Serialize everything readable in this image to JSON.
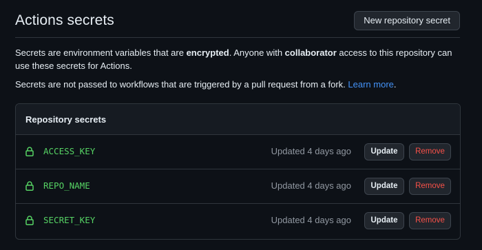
{
  "header": {
    "title": "Actions secrets",
    "new_secret_label": "New repository secret"
  },
  "description": {
    "p1_part1": "Secrets are environment variables that are ",
    "p1_bold1": "encrypted",
    "p1_part2": ". Anyone with ",
    "p1_bold2": "collaborator",
    "p1_part3": " access to this repository can use these secrets for Actions.",
    "p2_text": "Secrets are not passed to workflows that are triggered by a pull request from a fork. ",
    "p2_link": "Learn more",
    "p2_end": "."
  },
  "secrets": {
    "title": "Repository secrets",
    "items": [
      {
        "name": "ACCESS_KEY",
        "updated": "Updated 4 days ago",
        "update_label": "Update",
        "remove_label": "Remove"
      },
      {
        "name": "REPO_NAME",
        "updated": "Updated 4 days ago",
        "update_label": "Update",
        "remove_label": "Remove"
      },
      {
        "name": "SECRET_KEY",
        "updated": "Updated 4 days ago",
        "update_label": "Update",
        "remove_label": "Remove"
      }
    ]
  },
  "colors": {
    "background": "#0d1117",
    "secret_name": "#56d364",
    "remove": "#f85149",
    "link": "#4493f8"
  },
  "icons": {
    "lock": "lock-icon"
  }
}
